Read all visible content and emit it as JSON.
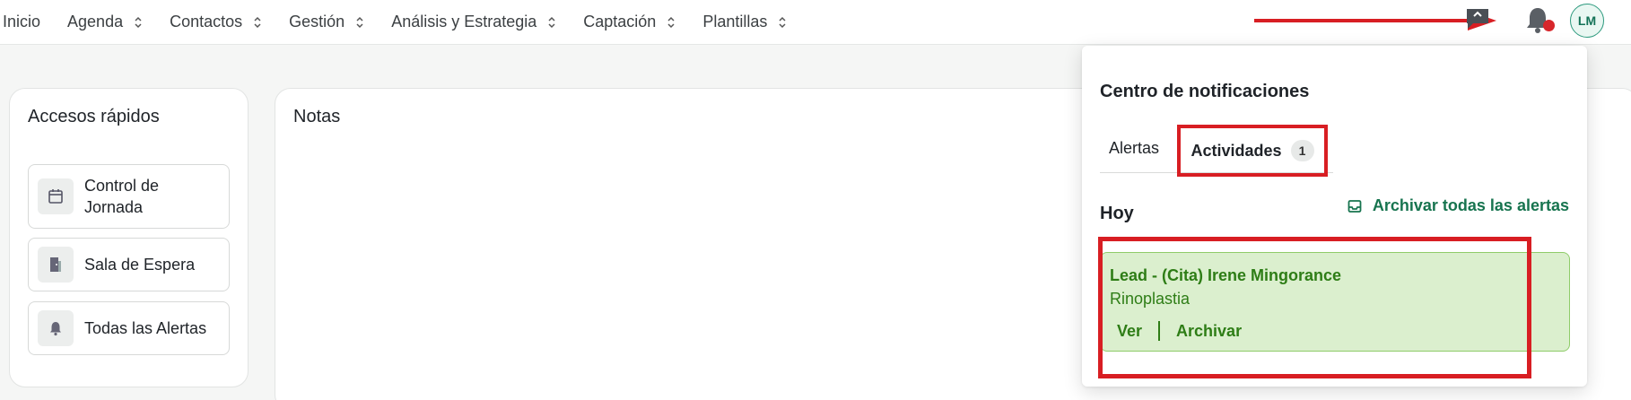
{
  "nav": {
    "items": [
      {
        "label": "Inicio",
        "has_chevron": false
      },
      {
        "label": "Agenda",
        "has_chevron": true
      },
      {
        "label": "Contactos",
        "has_chevron": true
      },
      {
        "label": "Gestión",
        "has_chevron": true
      },
      {
        "label": "Análisis y Estrategia",
        "has_chevron": true
      },
      {
        "label": "Captación",
        "has_chevron": true
      },
      {
        "label": "Plantillas",
        "has_chevron": true
      }
    ],
    "icons": [
      "chat-icon",
      "bell-icon"
    ],
    "avatar_initials": "LM"
  },
  "quick_access": {
    "title": "Accesos rápidos",
    "items": [
      {
        "label": "Control de Jornada",
        "icon": "calendar-icon"
      },
      {
        "label": "Sala de Espera",
        "icon": "door-icon"
      },
      {
        "label": "Todas las Alertas",
        "icon": "bell-icon"
      }
    ]
  },
  "notes": {
    "title": "Notas"
  },
  "notifications": {
    "title": "Centro de notificaciones",
    "tabs": [
      {
        "label": "Alertas"
      },
      {
        "label": "Actividades",
        "count": "1"
      }
    ],
    "section": "Hoy",
    "archive_all_label": "Archivar todas las alertas",
    "items": [
      {
        "title": "Lead - (Cita) Irene Mingorance",
        "subtitle": "Rinoplastia",
        "actions": [
          "Ver",
          "Archivar"
        ]
      }
    ]
  },
  "colors": {
    "accent_green": "#17744f",
    "notification_bg": "#dbefce",
    "highlight_red": "#d81e23"
  }
}
